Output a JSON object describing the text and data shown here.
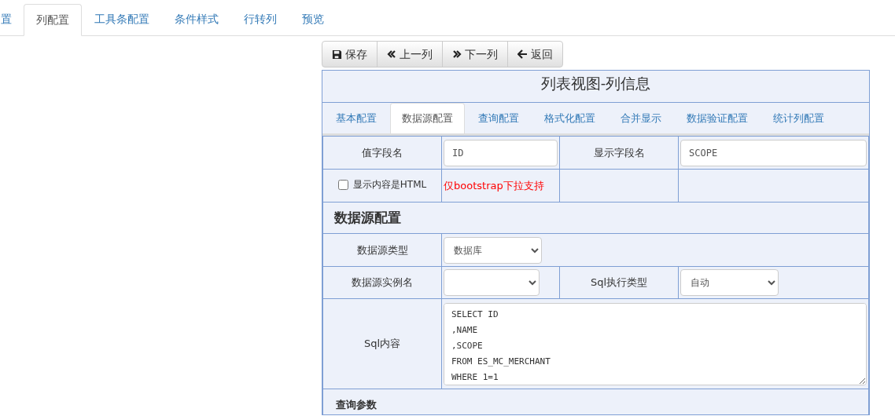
{
  "top_tabs": [
    {
      "label": "置",
      "selected": false
    },
    {
      "label": "列配置",
      "selected": true
    },
    {
      "label": "工具条配置",
      "selected": false
    },
    {
      "label": "条件样式",
      "selected": false
    },
    {
      "label": "行转列",
      "selected": false
    },
    {
      "label": "预览",
      "selected": false
    }
  ],
  "toolbar": [
    {
      "kind": "save",
      "label": "保存"
    },
    {
      "kind": "prev",
      "label": "上一列"
    },
    {
      "kind": "next",
      "label": "下一列"
    },
    {
      "kind": "back",
      "label": "返回"
    }
  ],
  "panel_title": "列表视图-列信息",
  "inner_tabs": [
    {
      "label": "基本配置",
      "selected": false
    },
    {
      "label": "数据源配置",
      "selected": true
    },
    {
      "label": "查询配置",
      "selected": false
    },
    {
      "label": "格式化配置",
      "selected": false
    },
    {
      "label": "合并显示",
      "selected": false
    },
    {
      "label": "数据验证配置",
      "selected": false
    },
    {
      "label": "统计列配置",
      "selected": false
    }
  ],
  "value_field": {
    "label": "值字段名",
    "value": "ID"
  },
  "display_field": {
    "label": "显示字段名",
    "value": "SCOPE"
  },
  "html_checkbox": {
    "label": "显示内容是HTML",
    "checked": false
  },
  "html_note": "仅bootstrap下拉支持",
  "section_title": "数据源配置",
  "source_type": {
    "label": "数据源类型",
    "value": "数据库"
  },
  "source_instance": {
    "label": "数据源实例名"
  },
  "sql_exec_type": {
    "label": "Sql执行类型",
    "value": "自动"
  },
  "sql_content": {
    "label": "Sql内容",
    "lines": [
      "SELECT ID",
      ",NAME",
      ",SCOPE",
      "FROM ES_MC_MERCHANT",
      "WHERE 1=1"
    ]
  },
  "query_params_title": "查询参数"
}
